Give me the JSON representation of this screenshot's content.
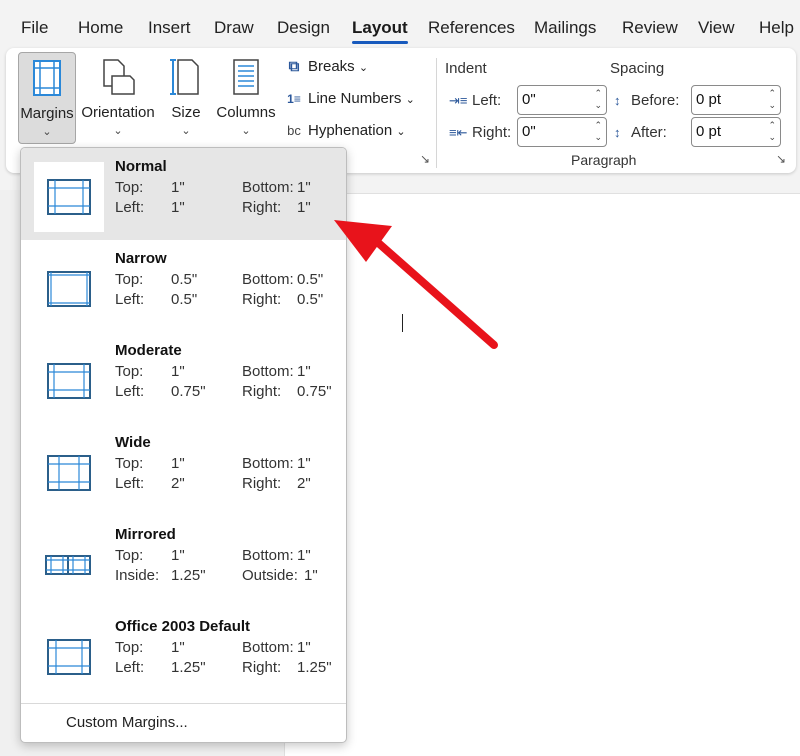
{
  "menu": {
    "tabs": [
      "File",
      "Home",
      "Insert",
      "Draw",
      "Design",
      "Layout",
      "References",
      "Mailings",
      "Review",
      "View",
      "Help"
    ],
    "active_tab": "Layout"
  },
  "ribbon": {
    "page_setup": {
      "margins_label": "Margins",
      "orientation_label": "Orientation",
      "size_label": "Size",
      "columns_label": "Columns",
      "breaks_label": "Breaks",
      "line_numbers_label": "Line Numbers",
      "hyphenation_label": "Hyphenation"
    },
    "paragraph": {
      "indent_heading": "Indent",
      "spacing_heading": "Spacing",
      "left_label": "Left:",
      "left_value": "0\"",
      "right_label": "Right:",
      "right_value": "0\"",
      "before_label": "Before:",
      "before_value": "0 pt",
      "after_label": "After:",
      "after_value": "0 pt",
      "caption": "Paragraph"
    }
  },
  "margins_menu": {
    "options": [
      {
        "name": "Normal",
        "k1": "Top:",
        "v1": "1\"",
        "k2": "Bottom:",
        "v2": "1\"",
        "k3": "Left:",
        "v3": "1\"",
        "k4": "Right:",
        "v4": "1\""
      },
      {
        "name": "Narrow",
        "k1": "Top:",
        "v1": "0.5\"",
        "k2": "Bottom:",
        "v2": "0.5\"",
        "k3": "Left:",
        "v3": "0.5\"",
        "k4": "Right:",
        "v4": "0.5\""
      },
      {
        "name": "Moderate",
        "k1": "Top:",
        "v1": "1\"",
        "k2": "Bottom:",
        "v2": "1\"",
        "k3": "Left:",
        "v3": "0.75\"",
        "k4": "Right:",
        "v4": "0.75\""
      },
      {
        "name": "Wide",
        "k1": "Top:",
        "v1": "1\"",
        "k2": "Bottom:",
        "v2": "1\"",
        "k3": "Left:",
        "v3": "2\"",
        "k4": "Right:",
        "v4": "2\""
      },
      {
        "name": "Mirrored",
        "k1": "Top:",
        "v1": "1\"",
        "k2": "Bottom:",
        "v2": "1\"",
        "k3": "Inside:",
        "v3": "1.25\"",
        "k4": "Outside:",
        "v4": "1\""
      },
      {
        "name": "Office 2003 Default",
        "k1": "Top:",
        "v1": "1\"",
        "k2": "Bottom:",
        "v2": "1\"",
        "k3": "Left:",
        "v3": "1.25\"",
        "k4": "Right:",
        "v4": "1.25\""
      }
    ],
    "custom_label": "Custom Margins..."
  },
  "colors": {
    "accent": "#185abd",
    "icon_blue": "#2b88d8",
    "arrow_red": "#e8131b",
    "hover_gray": "#e6e6e6"
  }
}
